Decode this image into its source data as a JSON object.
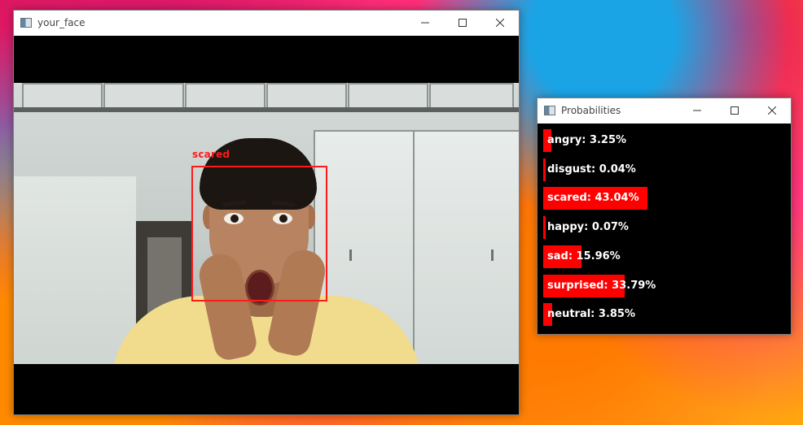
{
  "face_window": {
    "title": "your_face",
    "detection_label": "scared",
    "box_color": "#ff1a1a"
  },
  "prob_window": {
    "title": "Probabilities",
    "bar_color": "#ff0000",
    "items": [
      {
        "label": "angry: 3.25%",
        "value": 0.0325
      },
      {
        "label": "disgust: 0.04%",
        "value": 0.0004
      },
      {
        "label": "scared: 43.04%",
        "value": 0.4304
      },
      {
        "label": "happy: 0.07%",
        "value": 0.0007
      },
      {
        "label": "sad: 15.96%",
        "value": 0.1596
      },
      {
        "label": "surprised: 33.79%",
        "value": 0.3379
      },
      {
        "label": "neutral: 3.85%",
        "value": 0.0385
      }
    ]
  },
  "icons": [
    "app-icon",
    "minimize-icon",
    "maximize-icon",
    "close-icon"
  ]
}
